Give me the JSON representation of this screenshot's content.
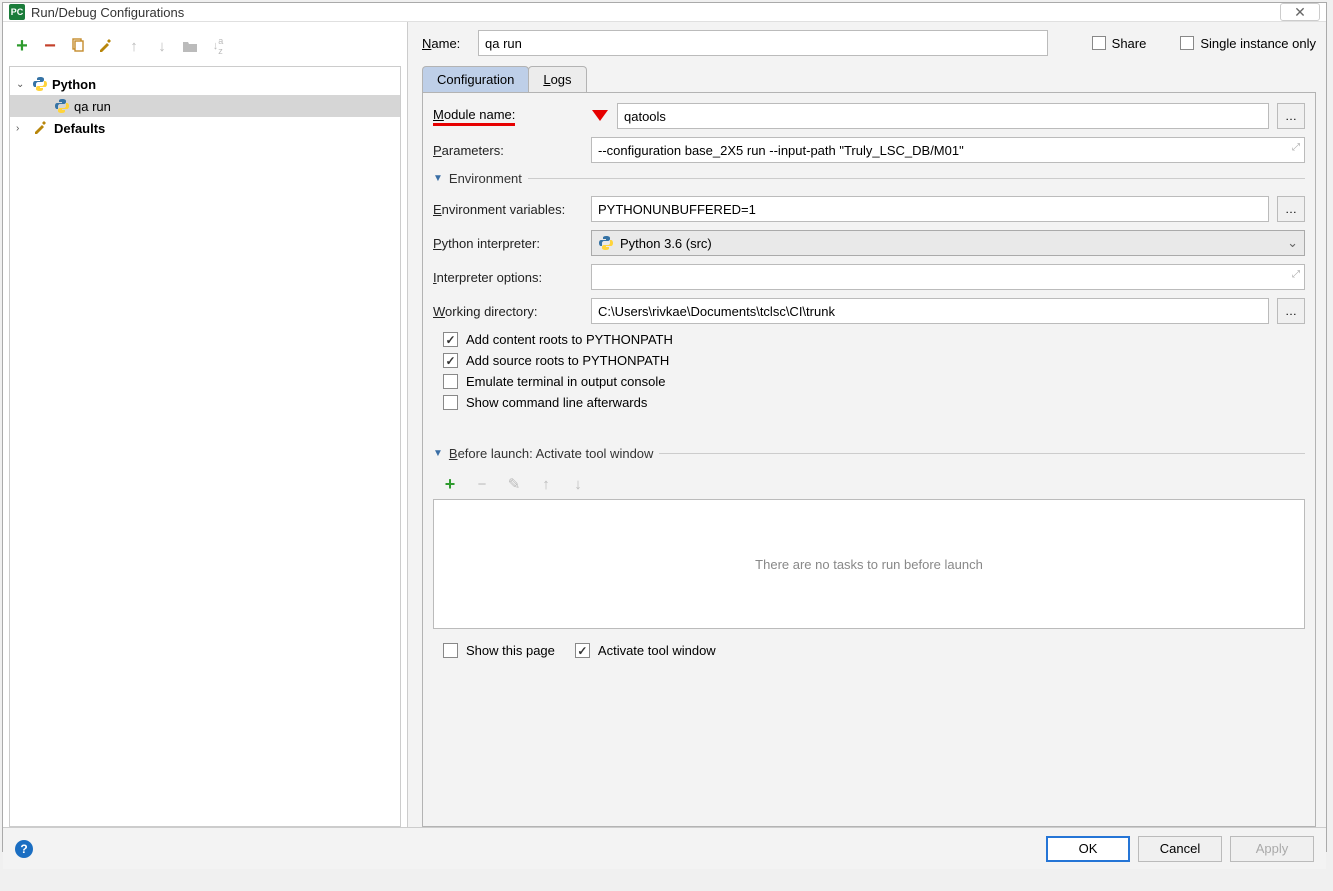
{
  "window": {
    "title": "Run/Debug Configurations"
  },
  "tree": {
    "python": "Python",
    "qa_run": "qa run",
    "defaults": "Defaults"
  },
  "name": {
    "label": "Name:",
    "value": "qa run",
    "share": "Share",
    "single_instance": "Single instance only"
  },
  "tabs": {
    "configuration": "Configuration",
    "logs": "Logs"
  },
  "form": {
    "module_label": "Module name:",
    "module_value": "qatools",
    "parameters_label": "Parameters:",
    "parameters_value": "--configuration base_2X5 run --input-path \"Truly_LSC_DB/M01\"",
    "env_header": "Environment",
    "env_vars_label": "Environment variables:",
    "env_vars_value": "PYTHONUNBUFFERED=1",
    "py_interp_label": "Python interpreter:",
    "py_interp_value": "Python 3.6 (src)",
    "interp_opts_label": "Interpreter options:",
    "interp_opts_value": "",
    "workdir_label": "Working directory:",
    "workdir_value": "C:\\Users\\rivkae\\Documents\\tclsc\\CI\\trunk",
    "add_content_roots": "Add content roots to PYTHONPATH",
    "add_source_roots": "Add source roots to PYTHONPATH",
    "emulate_terminal": "Emulate terminal in output console",
    "show_cmdline": "Show command line afterwards",
    "before_header": "Before launch: Activate tool window",
    "no_tasks": "There are no tasks to run before launch",
    "show_this_page": "Show this page",
    "activate_tool_window": "Activate tool window"
  },
  "footer": {
    "ok": "OK",
    "cancel": "Cancel",
    "apply": "Apply"
  }
}
